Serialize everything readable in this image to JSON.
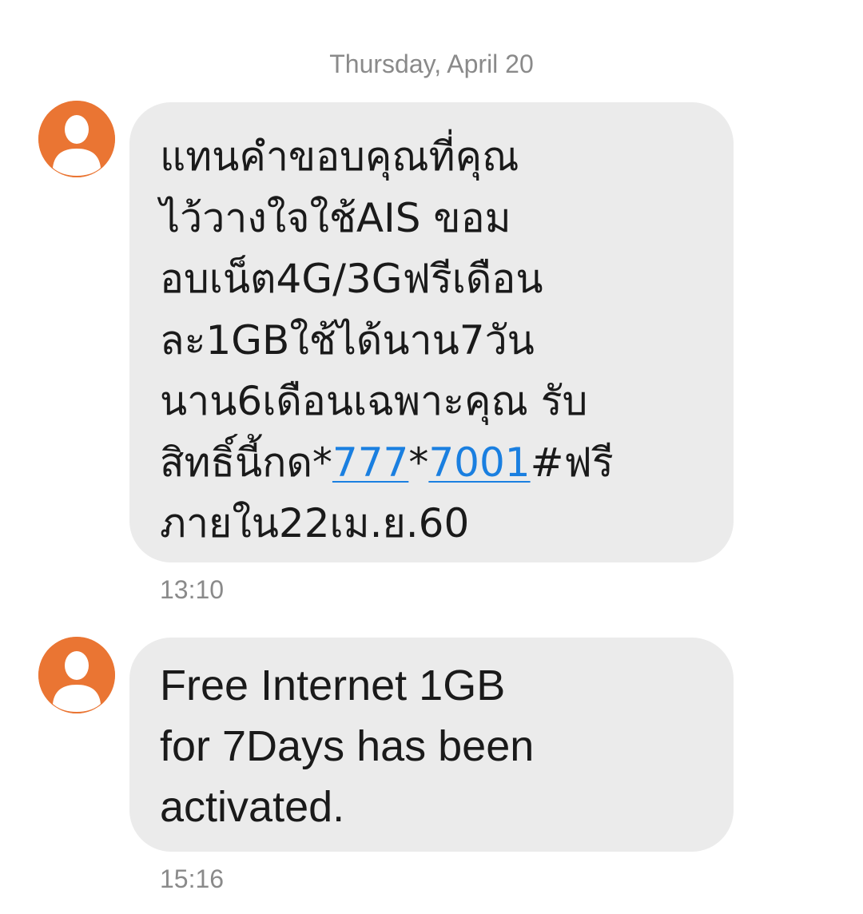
{
  "conversation": {
    "date_header": "Thursday, April 20",
    "messages": [
      {
        "avatar_icon": "person-icon",
        "text_lines": [
          "แทนคำขอบคุณที่คุณ",
          "ไว้วางใจใช้AIS ขอม",
          "อบเน็ต4G/3Gฟรีเดือน",
          "ละ1GBใช้ได้นาน7วัน",
          "นาน6เดือนเฉพาะคุณ รับ"
        ],
        "last_line_prefix": "สิทธิ์นี้กด*",
        "link_1": "777",
        "mid": "*",
        "link_2": "7001",
        "last_line_suffix": "#ฟรี",
        "final_line": "ภายใน22เม.ย.60",
        "time": "13:10"
      },
      {
        "avatar_icon": "person-icon",
        "text_lines": [
          "Free Internet 1GB",
          "for 7Days has been",
          "activated."
        ],
        "time": "15:16"
      }
    ]
  },
  "colors": {
    "avatar_bg": "#ea7533",
    "bubble_bg": "#ebebeb",
    "link": "#1a7fe0",
    "meta_text": "#8a8a8a"
  }
}
